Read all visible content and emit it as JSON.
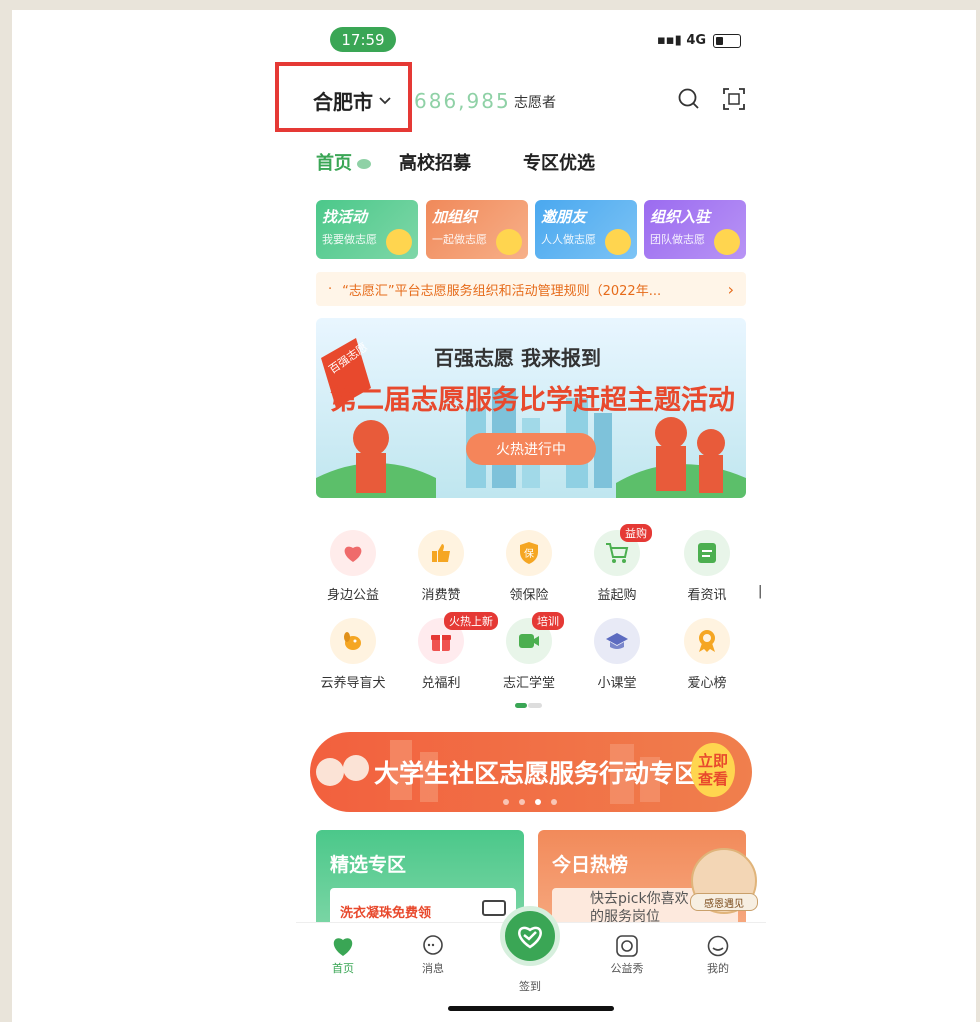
{
  "status": {
    "time": "17:59",
    "network": "4G"
  },
  "header": {
    "city": "合肥市",
    "volunteer_count": "686,985",
    "volunteer_label": "志愿者"
  },
  "tabs": [
    {
      "label": "首页"
    },
    {
      "label": "高校招募"
    },
    {
      "label": "专区优选"
    }
  ],
  "quick_cards": [
    {
      "title": "找活动",
      "subtitle": "我要做志愿",
      "color": "#4bc88a"
    },
    {
      "title": "加组织",
      "subtitle": "一起做志愿",
      "color": "#f0895a"
    },
    {
      "title": "邀朋友",
      "subtitle": "人人做志愿",
      "color": "#4aa8ef"
    },
    {
      "title": "组织入驻",
      "subtitle": "团队做志愿",
      "color": "#9b6bf0"
    }
  ],
  "notice": "“志愿汇”平台志愿服务组织和活动管理规则（2022年...",
  "main_banner": {
    "line1": "百强志愿 我来报到",
    "line2": "第二届志愿服务比学赶超主题活动",
    "button": "火热进行中",
    "flag": "百强志愿"
  },
  "grid_row1": [
    {
      "label": "身边公益",
      "icon": "heart-hands-icon",
      "color": "#ff8a80"
    },
    {
      "label": "消费赞",
      "icon": "thumb-up-icon",
      "color": "#ffb74d"
    },
    {
      "label": "领保险",
      "icon": "shield-icon",
      "color": "#ffb74d"
    },
    {
      "label": "益起购",
      "icon": "cart-icon",
      "color": "#66bb6a",
      "badge": "益购"
    },
    {
      "label": "看资讯",
      "icon": "news-icon",
      "color": "#66bb6a"
    }
  ],
  "grid_row2": [
    {
      "label": "云养导盲犬",
      "icon": "dog-icon",
      "color": "#ffb74d"
    },
    {
      "label": "兑福利",
      "icon": "gift-icon",
      "color": "#ef5350",
      "badge": "火热上新"
    },
    {
      "label": "志汇学堂",
      "icon": "video-icon",
      "color": "#66bb6a",
      "badge": "培训"
    },
    {
      "label": "小课堂",
      "icon": "graduation-cap-icon",
      "color": "#7986cb"
    },
    {
      "label": "爱心榜",
      "icon": "medal-icon",
      "color": "#ffb74d"
    }
  ],
  "activity_banner": {
    "title": "大学生社区志愿服务行动专区",
    "cta": "立即查看"
  },
  "panels": {
    "left": {
      "title": "精选专区",
      "item": "洗衣凝珠免费领"
    },
    "right": {
      "title": "今日热榜",
      "desc": "快去pick你喜欢的服务岗位",
      "badge": "感恩遇见"
    }
  },
  "tabbar": [
    {
      "label": "首页",
      "icon": "heart-home-icon"
    },
    {
      "label": "消息",
      "icon": "message-icon"
    },
    {
      "label": "签到",
      "icon": "checkin-icon"
    },
    {
      "label": "公益秀",
      "icon": "camera-icon"
    },
    {
      "label": "我的",
      "icon": "profile-icon"
    }
  ]
}
